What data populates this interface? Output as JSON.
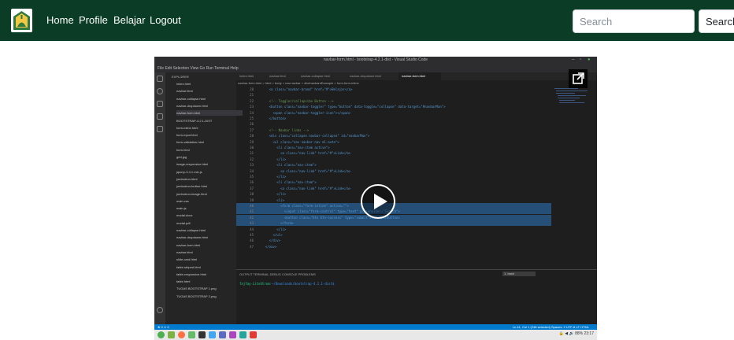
{
  "navbar": {
    "links": [
      "Home",
      "Profile",
      "Belajar",
      "Logout"
    ],
    "search_placeholder": "Search",
    "search_button": "Search",
    "background_color": "#0b3d26"
  },
  "video": {
    "window_title": "navbar-form.html - bootstrap-4.2.1-dist - Visual Studio Code",
    "menu": "File  Edit  Selection  View  Go  Run  Terminal  Help",
    "explorer_header": "EXPLORER",
    "explorer_items": [
      "index.html",
      "navbar.html",
      "navbar-collapse.html",
      "navbar-dropdown.html",
      "navbar-form.html",
      "BOOTSTRAP-4.2.1-DIST",
      "form-inline.html",
      "form-input.html",
      "form-validation.html",
      "form.html",
      "grid.jpg",
      "image-responsive.html",
      "jquery-3.4.1.min.js",
      "jumbotron.html",
      "jumbotron-button.html",
      "jumbotron-image.html",
      "main.css",
      "main.js",
      "modal.docx",
      "modal.pdf",
      "navbar-collapse.html",
      "navbar-dropdown.html",
      "navbar-form.html",
      "navbar.html",
      "slide-card.html",
      "table-striped.html",
      "table-responsive.html",
      "table.html",
      "TUGAS BOOTSTRAP 1.png",
      "TUGAS BOOTSTRAP 2.png"
    ],
    "tabs": [
      "index.html",
      "navbar.html",
      "navbar-collapse.html",
      "navbar-dropdown.html",
      "navbar-form.html"
    ],
    "breadcrumb": "navbar-form.html > html > body > nav.navbar > div#navbarsExample > form.form-inline",
    "code_lines": [
      {
        "n": "20",
        "code": "    <a class=\"navbar-brand\" href=\"#\">Belajar</a>"
      },
      {
        "n": "21",
        "code": ""
      },
      {
        "n": "22",
        "code": "    <!-- Toggler/collapsibe Button -->"
      },
      {
        "n": "23",
        "code": "    <button class=\"navbar-toggler\" type=\"button\" data-toggle=\"collapse\" data-target=\"#navbarMan\">"
      },
      {
        "n": "24",
        "code": "      <span class=\"navbar-toggler-icon\"></span>"
      },
      {
        "n": "25",
        "code": "    </button>"
      },
      {
        "n": "26",
        "code": ""
      },
      {
        "n": "27",
        "code": "    <!-- Navbar links -->"
      },
      {
        "n": "28",
        "code": "    <div class=\"collapse navbar-collapse\" id=\"navbarMan\">"
      },
      {
        "n": "29",
        "code": "      <ul class=\"nav navbar-nav ml-auto\">"
      },
      {
        "n": "30",
        "code": "        <li class=\"nav-item active\">"
      },
      {
        "n": "31",
        "code": "          <a class=\"nav-link\" href=\"#\">Link</a>"
      },
      {
        "n": "32",
        "code": "        </li>"
      },
      {
        "n": "33",
        "code": "        <li class=\"nav-item\">"
      },
      {
        "n": "34",
        "code": "          <a class=\"nav-link\" href=\"#\">Link</a>"
      },
      {
        "n": "35",
        "code": "        </li>"
      },
      {
        "n": "36",
        "code": "        <li class=\"nav-item\">"
      },
      {
        "n": "37",
        "code": "          <a class=\"nav-link\" href=\"#\">Link</a>"
      },
      {
        "n": "38",
        "code": "        </li>"
      },
      {
        "n": "39",
        "code": "        <li>"
      },
      {
        "n": "40",
        "code": "          <form class=\"form-inline\" action=\"\">"
      },
      {
        "n": "41",
        "code": "            <input class=\"form-control\" type=\"text\" placeholder=\"Search\">"
      },
      {
        "n": "42",
        "code": "            <button class=\"btn btn-success\" type=\"submit\">Search</button>"
      },
      {
        "n": "43",
        "code": "          </form>"
      },
      {
        "n": "44",
        "code": "        </li>"
      },
      {
        "n": "45",
        "code": "      </ul>"
      },
      {
        "n": "46",
        "code": "    </div>"
      },
      {
        "n": "47",
        "code": "  </nav>"
      }
    ],
    "panel_tabs": "OUTPUT   TERMINAL   DEBUG CONSOLE   PROBLEMS",
    "panel_select": "1: bash",
    "terminal_prompt": "fajfay-LiteStrom",
    "terminal_path": ":~/Downloads/bootstrap-4.2.1-dist$",
    "status_left": "⊗ 0 ⚠ 0",
    "status_right": "Ln 41, Col 1 (248 selected)   Spaces: 2   UTF-8   LF   HTML",
    "tray_text": "🔒 ◀ 🔊 88%  23:17"
  }
}
